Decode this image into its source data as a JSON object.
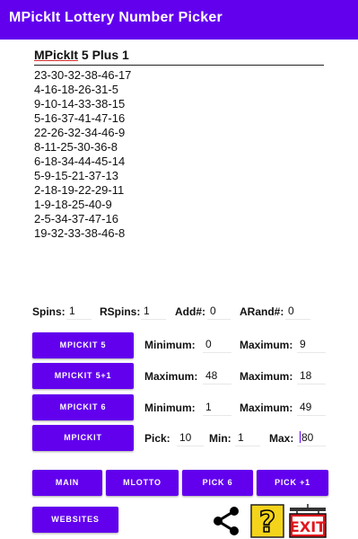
{
  "app_title": "MPickIt Lottery Number Picker",
  "section": {
    "brand": "MPickIt",
    "rest": " 5 Plus 1"
  },
  "numbers": [
    "23-30-32-38-46-17",
    "4-16-18-26-31-5",
    "9-10-14-33-38-15",
    "5-16-37-41-47-16",
    "22-26-32-34-46-9",
    "8-11-25-30-36-8",
    "6-18-34-44-45-14",
    "5-9-15-21-37-13",
    "2-18-19-22-29-11",
    "1-9-18-25-40-9",
    "2-5-34-37-47-16",
    "19-32-33-38-46-8"
  ],
  "stats": {
    "spins_label": "Spins:",
    "spins_value": "1",
    "rspins_label": "RSpins:",
    "rspins_value": "1",
    "add_label": "Add#:",
    "add_value": "0",
    "arand_label": "ARand#:",
    "arand_value": "0"
  },
  "rows": {
    "r1": {
      "button": "MPICKIT 5",
      "l1": "Minimum:",
      "v1": "0",
      "l2": "Maximum:",
      "v2": "9"
    },
    "r2": {
      "button": "MPICKIT 5+1",
      "l1": "Maximum:",
      "v1": "48",
      "l2": "Maximum:",
      "v2": "18"
    },
    "r3": {
      "button": "MPICKIT 6",
      "l1": "Minimum:",
      "v1": "1",
      "l2": "Maximum:",
      "v2": "49"
    },
    "r4": {
      "button": "MPICKIT",
      "pick_label": "Pick:",
      "pick_value": "10",
      "min_label": "Min:",
      "min_value": "1",
      "max_label": "Max:",
      "max_value": "80"
    }
  },
  "nav": {
    "main": "MAIN",
    "mlotto": "MLOTTO",
    "pick6": "PICK 6",
    "pickplus1": "PICK +1",
    "websites": "WEBSITES"
  },
  "icons": {
    "share": "share-icon",
    "help": "question-mark-icon",
    "exit": "exit-sign-icon",
    "exit_text": "EXIT"
  },
  "colors": {
    "accent": "#6200ee",
    "help_bg": "#f4d41a",
    "exit_red": "#e1171e"
  }
}
